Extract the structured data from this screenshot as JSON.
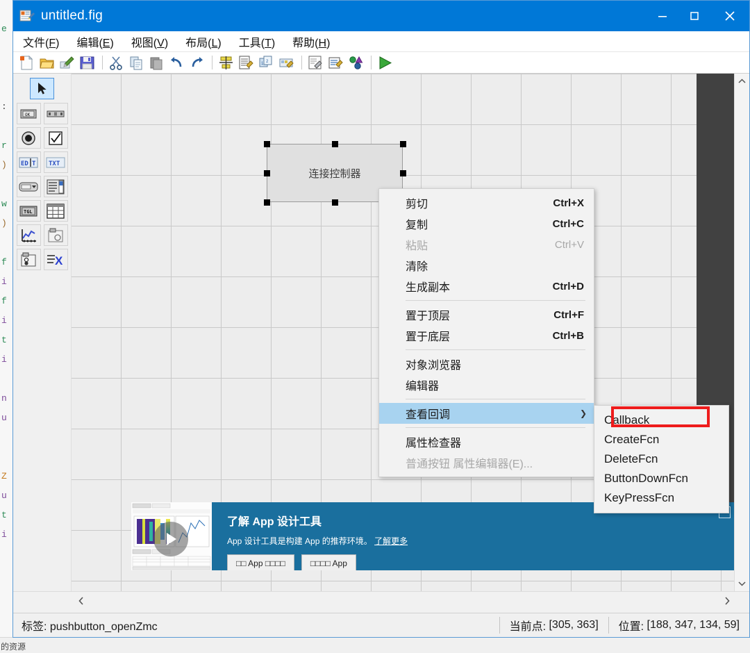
{
  "window": {
    "title": "untitled.fig",
    "icon": "figure-file-icon",
    "minimize": "minimize-icon",
    "maximize": "maximize-icon",
    "close": "close-icon"
  },
  "menubar": {
    "items": [
      {
        "label": "文件",
        "mnemonic": "F"
      },
      {
        "label": "编辑",
        "mnemonic": "E"
      },
      {
        "label": "视图",
        "mnemonic": "V"
      },
      {
        "label": "布局",
        "mnemonic": "L"
      },
      {
        "label": "工具",
        "mnemonic": "T"
      },
      {
        "label": "帮助",
        "mnemonic": "H"
      }
    ]
  },
  "toolbar": {
    "items": [
      {
        "name": "new-figure-icon"
      },
      {
        "name": "open-folder-icon"
      },
      {
        "name": "open-in-editor-icon"
      },
      {
        "name": "save-icon"
      },
      {
        "name": "separator"
      },
      {
        "name": "cut-icon"
      },
      {
        "name": "copy-icon"
      },
      {
        "name": "paste-icon"
      },
      {
        "name": "undo-icon"
      },
      {
        "name": "redo-icon"
      },
      {
        "name": "separator"
      },
      {
        "name": "align-objects-icon"
      },
      {
        "name": "menu-editor-icon"
      },
      {
        "name": "tab-order-editor-icon"
      },
      {
        "name": "toolbar-editor-icon"
      },
      {
        "name": "separator"
      },
      {
        "name": "m-file-editor-icon"
      },
      {
        "name": "property-inspector-icon"
      },
      {
        "name": "object-browser-icon"
      },
      {
        "name": "separator"
      },
      {
        "name": "run-figure-icon"
      }
    ]
  },
  "palette": {
    "pointer": {
      "name": "pointer-tool",
      "selected": true
    },
    "components": [
      {
        "name": "push-button-tool",
        "glyph": "OK"
      },
      {
        "name": "slider-tool",
        "glyph": "slider"
      },
      {
        "name": "radio-button-tool",
        "glyph": "radio"
      },
      {
        "name": "check-box-tool",
        "glyph": "check"
      },
      {
        "name": "edit-text-tool",
        "glyph": "EDIT"
      },
      {
        "name": "static-text-tool",
        "glyph": "TXT"
      },
      {
        "name": "pop-up-menu-tool",
        "glyph": "popup"
      },
      {
        "name": "listbox-tool",
        "glyph": "listbox"
      },
      {
        "name": "toggle-button-tool",
        "glyph": "TGL"
      },
      {
        "name": "table-tool",
        "glyph": "table"
      },
      {
        "name": "axes-tool",
        "glyph": "axes"
      },
      {
        "name": "panel-tool",
        "glyph": "panel"
      },
      {
        "name": "button-group-tool",
        "glyph": "group"
      },
      {
        "name": "activex-control-tool",
        "glyph": "X"
      }
    ]
  },
  "canvas": {
    "selected_component": {
      "label": "连接控制器",
      "type": "pushbutton",
      "handles": 8
    }
  },
  "context_menu": {
    "items": [
      {
        "label": "剪切",
        "accel": "Ctrl+X",
        "enabled": true,
        "sep_after": false
      },
      {
        "label": "复制",
        "accel": "Ctrl+C",
        "enabled": true,
        "sep_after": false
      },
      {
        "label": "粘贴",
        "accel": "Ctrl+V",
        "enabled": false,
        "sep_after": false
      },
      {
        "label": "清除",
        "accel": "",
        "enabled": true,
        "sep_after": false
      },
      {
        "label": "生成副本",
        "accel": "Ctrl+D",
        "enabled": true,
        "sep_after": true
      },
      {
        "label": "置于顶层",
        "accel": "Ctrl+F",
        "enabled": true,
        "sep_after": false
      },
      {
        "label": "置于底层",
        "accel": "Ctrl+B",
        "enabled": true,
        "sep_after": true
      },
      {
        "label": "对象浏览器",
        "accel": "",
        "enabled": true,
        "sep_after": false
      },
      {
        "label": "编辑器",
        "accel": "",
        "enabled": true,
        "sep_after": true
      },
      {
        "label": "查看回调",
        "accel": "",
        "enabled": true,
        "sep_after": true,
        "highlighted": true,
        "submenu": true
      },
      {
        "label": "属性检查器",
        "accel": "",
        "enabled": true,
        "sep_after": false
      },
      {
        "label": "普通按钮 属性编辑器(E)...",
        "accel": "",
        "enabled": false,
        "sep_after": false
      }
    ]
  },
  "submenu": {
    "items": [
      {
        "label": "Callback",
        "outlined": true
      },
      {
        "label": "CreateFcn",
        "outlined": false
      },
      {
        "label": "DeleteFcn",
        "outlined": false
      },
      {
        "label": "ButtonDownFcn",
        "outlined": false
      },
      {
        "label": "KeyPressFcn",
        "outlined": false
      }
    ],
    "highlight_color": "#ee1c1c"
  },
  "promo": {
    "title": "了解 App 设计工具",
    "subtitle": "App 设计工具是构建 App 的推荐环境。",
    "link": "了解更多",
    "buttons": [
      "□□ App □□□□",
      "□□□□ App"
    ],
    "close": "collapse-icon",
    "play": "play-icon"
  },
  "scrollbars": {
    "up": "chevron-up-icon",
    "down": "chevron-down-icon",
    "left": "chevron-left-icon",
    "right": "chevron-right-icon"
  },
  "statusbar": {
    "tag_label": "标签:",
    "tag_value": "pushbutton_openZmc",
    "current_point_label": "当前点:",
    "current_point_value": "[305, 363]",
    "position_label": "位置:",
    "position_value": "[188, 347, 134, 59]"
  },
  "background_editor": {
    "chars": [
      "e",
      "",
      "",
      "",
      ":",
      "",
      "r",
      ")",
      "",
      "w",
      ")",
      "",
      "f",
      "i",
      "f",
      "i",
      "t",
      "i",
      "",
      "n",
      "u",
      "",
      "",
      "Z",
      "u",
      "t",
      "i"
    ],
    "bottom_text": "的资源"
  },
  "colors": {
    "titlebar": "#0078d7",
    "menu_highlight": "#a8d3f0",
    "promo_bg": "#1a6f9e",
    "red_outline": "#ee1c1c",
    "canvas_bg": "#ededed"
  }
}
